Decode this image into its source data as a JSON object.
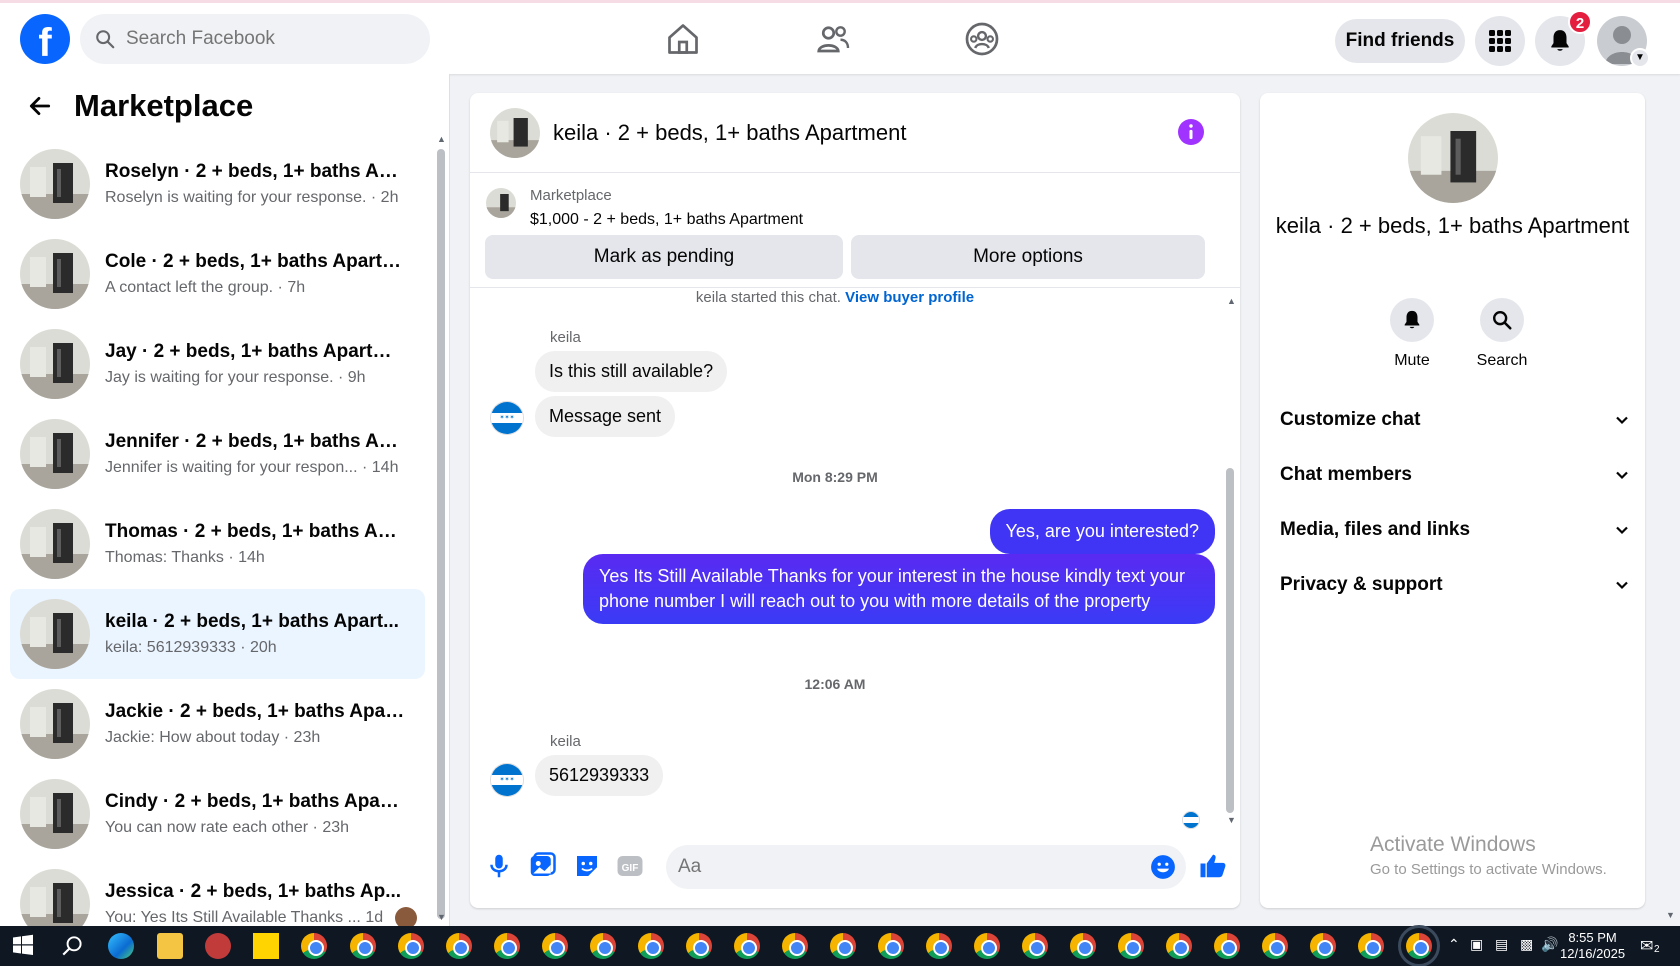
{
  "topbar": {
    "search_placeholder": "Search Facebook",
    "find_friends_label": "Find friends",
    "notification_count": "2"
  },
  "sidebar": {
    "title": "Marketplace",
    "conversations": [
      {
        "title": "Roselyn · 2 + beds, 1+ baths Apa...",
        "subtitle": "Roselyn is waiting for your response. · 2h"
      },
      {
        "title": "Cole · 2 + beds, 1+ baths Apartm...",
        "subtitle": "A contact left the group. · 7h"
      },
      {
        "title": "Jay · 2 + beds, 1+ baths Apartment",
        "subtitle": "Jay is waiting for your response. · 9h"
      },
      {
        "title": "Jennifer · 2 + beds, 1+ baths Apa...",
        "subtitle": "Jennifer is waiting for your respon... · 14h"
      },
      {
        "title": "Thomas · 2 + beds, 1+ baths Apa...",
        "subtitle": "Thomas: Thanks · 14h"
      },
      {
        "title": "keila · 2 + beds, 1+ baths Apart...",
        "subtitle": "keila: 5612939333 · 20h"
      },
      {
        "title": "Jackie · 2 + beds, 1+ baths Apart...",
        "subtitle": "Jackie: How about today · 23h"
      },
      {
        "title": "Cindy · 2 + beds, 1+ baths Apart...",
        "subtitle": "You can now rate each other · 23h"
      },
      {
        "title": "Jessica · 2 + beds, 1+ baths Ap...",
        "subtitle": "You: Yes Its Still Available Thanks ...  1d"
      }
    ]
  },
  "chat": {
    "title": "keila · 2 + beds, 1+ baths Apartment",
    "listing_label": "Marketplace",
    "listing_price": "$1,000 - 2 + beds, 1+ baths Apartment",
    "mark_pending_label": "Mark as pending",
    "more_options_label": "More options",
    "started_text": "keila started this chat.",
    "view_profile_label": "View buyer profile",
    "sender_name": "keila",
    "msg_1": "Is this still available?",
    "msg_2": "Message sent",
    "time_1": "Mon 8:29 PM",
    "msg_3": "Yes, are you interested?",
    "msg_4": "Yes Its Still Available Thanks for your interest in the house kindly text your phone number I will reach out to you with more details of the property",
    "time_2": "12:06 AM",
    "msg_5": "5612939333",
    "composer_placeholder": "Aa",
    "gif_label": "GIF"
  },
  "right_panel": {
    "title": "keila · 2 + beds, 1+ baths Apartment",
    "mute_label": "Mute",
    "search_label": "Search",
    "sections": [
      "Customize chat",
      "Chat members",
      "Media, files and links",
      "Privacy & support"
    ],
    "activate_title": "Activate Windows",
    "activate_sub": "Go to Settings to activate Windows."
  },
  "taskbar": {
    "time": "8:55 PM",
    "date": "12/16/2025",
    "notif_count": "2"
  },
  "colors": {
    "brand": "#0866ff",
    "bubble_out": "#4035f4",
    "active_row": "#ebf5ff",
    "notification": "#e41e3f"
  }
}
